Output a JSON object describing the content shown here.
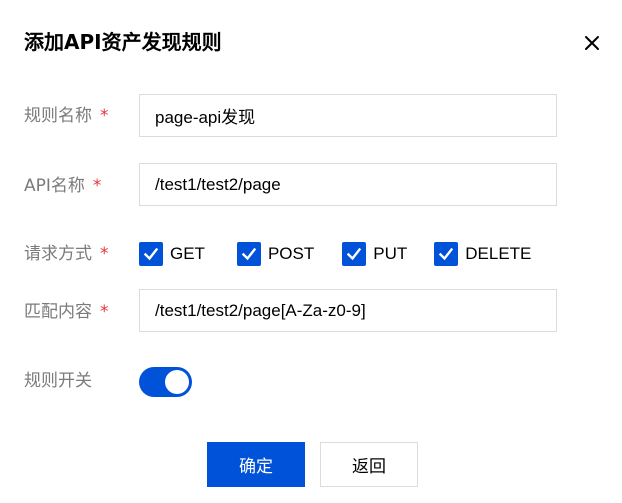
{
  "dialog": {
    "title": "添加API资产发现规则",
    "close_icon": "close-icon"
  },
  "form": {
    "required_mark": "*",
    "rule_name": {
      "label": "规则名称",
      "value": "page-api发现"
    },
    "api_name": {
      "label": "API名称",
      "value": "/test1/test2/page"
    },
    "methods": {
      "label": "请求方式",
      "options": [
        {
          "label": "GET",
          "checked": true
        },
        {
          "label": "POST",
          "checked": true
        },
        {
          "label": "PUT",
          "checked": true
        },
        {
          "label": "DELETE",
          "checked": true
        }
      ]
    },
    "match": {
      "label": "匹配内容",
      "value": "/test1/test2/page[A-Za-z0-9]"
    },
    "switch": {
      "label": "规则开关",
      "on": true
    }
  },
  "actions": {
    "confirm_label": "确定",
    "back_label": "返回"
  },
  "colors": {
    "accent": "#0052d9",
    "required": "#e5383b",
    "label": "#7b7b7b",
    "border": "#dcdcdc"
  }
}
